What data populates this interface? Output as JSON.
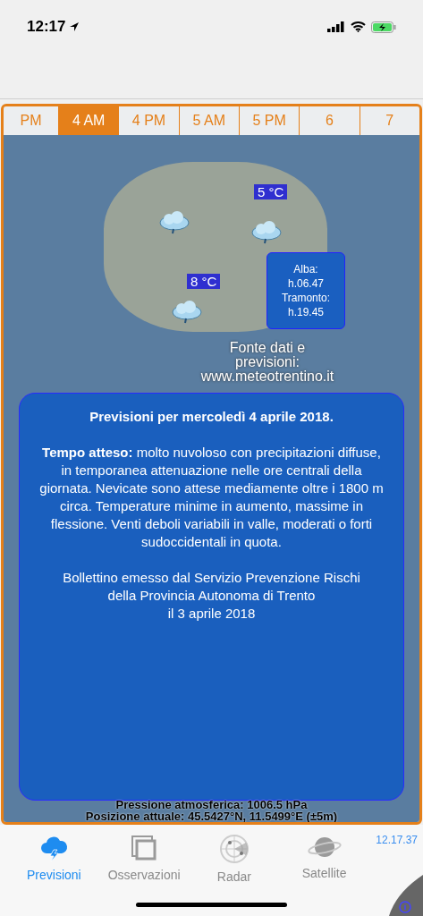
{
  "status_bar": {
    "time": "12:17"
  },
  "time_tabs": [
    {
      "label": "PM",
      "selected": false
    },
    {
      "label": "4 AM",
      "selected": true
    },
    {
      "label": "4 PM",
      "selected": false
    },
    {
      "label": "5 AM",
      "selected": false
    },
    {
      "label": "5 PM",
      "selected": false
    },
    {
      "label": "6",
      "selected": false
    },
    {
      "label": "7",
      "selected": false
    }
  ],
  "map": {
    "temperatures": [
      "5 °C",
      "8 °C"
    ],
    "sun_box": [
      "Alba:",
      "h.06.47",
      "Tramonto:",
      "h.19.45"
    ],
    "source": [
      "Fonte dati e",
      "previsioni:",
      "www.meteotrentino.it"
    ],
    "forecast": {
      "title": "Previsioni per mercoledì 4 aprile 2018.",
      "body": "**Tempo atteso:** molto nuvoloso con precipitazioni diffuse, in temporanea attenuazione nelle ore centrali della giornata. Nevicate sono attese mediamente oltre i 1800 m circa. Temperature minime in aumento, massime in flessione. Venti deboli variabili in valle, moderati o forti sudoccidentali in quota.",
      "issued": [
        "Bollettino emesso dal Servizio Prevenzione Rischi",
        "della Provincia Autonoma di Trento",
        "il 3 aprile 2018"
      ]
    },
    "pressure": "Pressione atmosferica: 1006.5 hPa",
    "position": "Posizione attuale: 45.5427°N, 11.5499°E (±5m)"
  },
  "clock": "12.17.37",
  "bottom_tabs": [
    {
      "label": "Previsioni",
      "selected": true,
      "kind": "cloud"
    },
    {
      "label": "Osservazioni",
      "selected": false,
      "kind": "photos"
    },
    {
      "label": "Radar",
      "selected": false,
      "kind": "radar"
    },
    {
      "label": "Satellite",
      "selected": false,
      "kind": "planet"
    }
  ]
}
